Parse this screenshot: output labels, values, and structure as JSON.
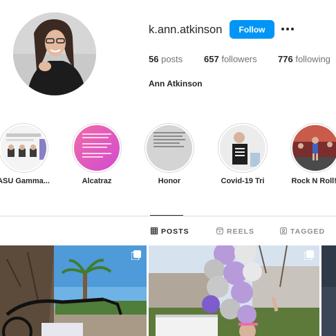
{
  "profile": {
    "username": "k.ann.atkinson",
    "follow_label": "Follow",
    "more_icon": "more-horizontal-icon",
    "stats": {
      "posts_count": "56",
      "posts_label": "posts",
      "followers_count": "657",
      "followers_label": "followers",
      "following_count": "776",
      "following_label": "following"
    },
    "full_name": "Ann Atkinson"
  },
  "highlights": [
    {
      "label": "ASU Gamma..."
    },
    {
      "label": "Alcatraz"
    },
    {
      "label": "Honor"
    },
    {
      "label": "Covid-19 Tri"
    },
    {
      "label": "Rock N Roll!!"
    }
  ],
  "tabs": [
    {
      "label": "POSTS",
      "icon": "grid-icon",
      "active": true
    },
    {
      "label": "REELS",
      "icon": "reels-icon",
      "active": false
    },
    {
      "label": "TAGGED",
      "icon": "tagged-icon",
      "active": false
    }
  ],
  "colors": {
    "accent": "#0095f6",
    "text": "#262626",
    "muted": "#737373",
    "border": "#dbdbdb"
  }
}
